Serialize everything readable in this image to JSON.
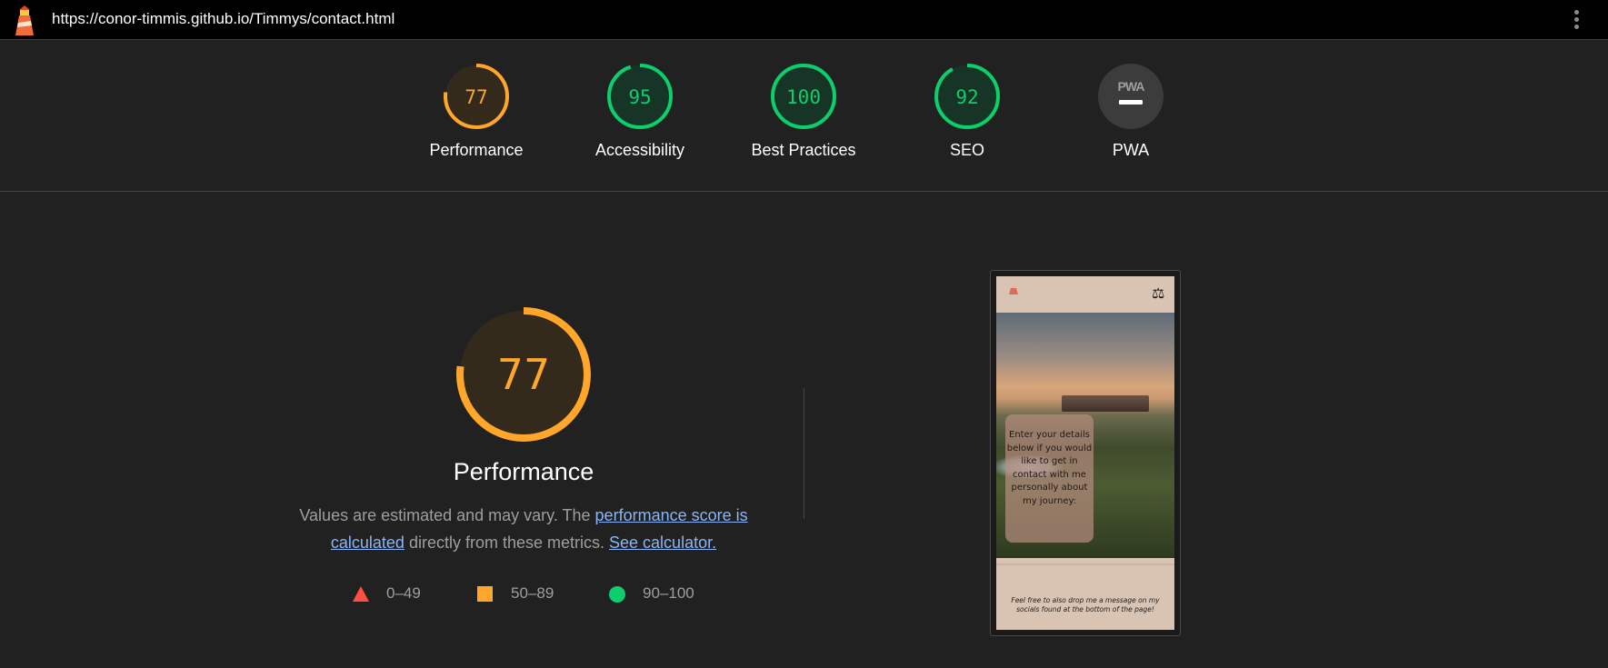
{
  "topbar": {
    "url": "https://conor-timmis.github.io/Timmys/contact.html",
    "logo_icon": "lighthouse-icon",
    "menu_icon": "kebab-menu-icon"
  },
  "colors": {
    "average": "#ffa62b",
    "pass": "#0cce6b",
    "fail": "#ff4e42",
    "na": "#757575",
    "background": "#212121",
    "link": "#8ab4f8"
  },
  "gauges": [
    {
      "score": "77",
      "label": "Performance",
      "value": 77,
      "rating": "average"
    },
    {
      "score": "95",
      "label": "Accessibility",
      "value": 95,
      "rating": "pass"
    },
    {
      "score": "100",
      "label": "Best Practices",
      "value": 100,
      "rating": "pass"
    },
    {
      "score": "92",
      "label": "SEO",
      "value": 92,
      "rating": "pass"
    },
    {
      "score": "PWA",
      "label": "PWA",
      "value": null,
      "rating": "na"
    }
  ],
  "performance": {
    "score": "77",
    "value": 77,
    "title": "Performance",
    "desc_prefix": "Values are estimated and may vary. The ",
    "desc_link1": "performance score is calculated",
    "desc_middle": " directly from these metrics. ",
    "desc_link2": "See calculator."
  },
  "legend": [
    {
      "range": "0–49",
      "shape": "triangle-icon",
      "color": "#ff4e42"
    },
    {
      "range": "50–89",
      "shape": "square-icon",
      "color": "#ffa62b"
    },
    {
      "range": "90–100",
      "shape": "circle-icon",
      "color": "#0cce6b"
    }
  ],
  "screenshot": {
    "card_text": "Enter your details below if you would like to get in contact with me personally about my journey:",
    "note_text": "Feel free to also drop me a message on my socials found at the bottom of the page!",
    "scale_icon": "scale-icon"
  }
}
